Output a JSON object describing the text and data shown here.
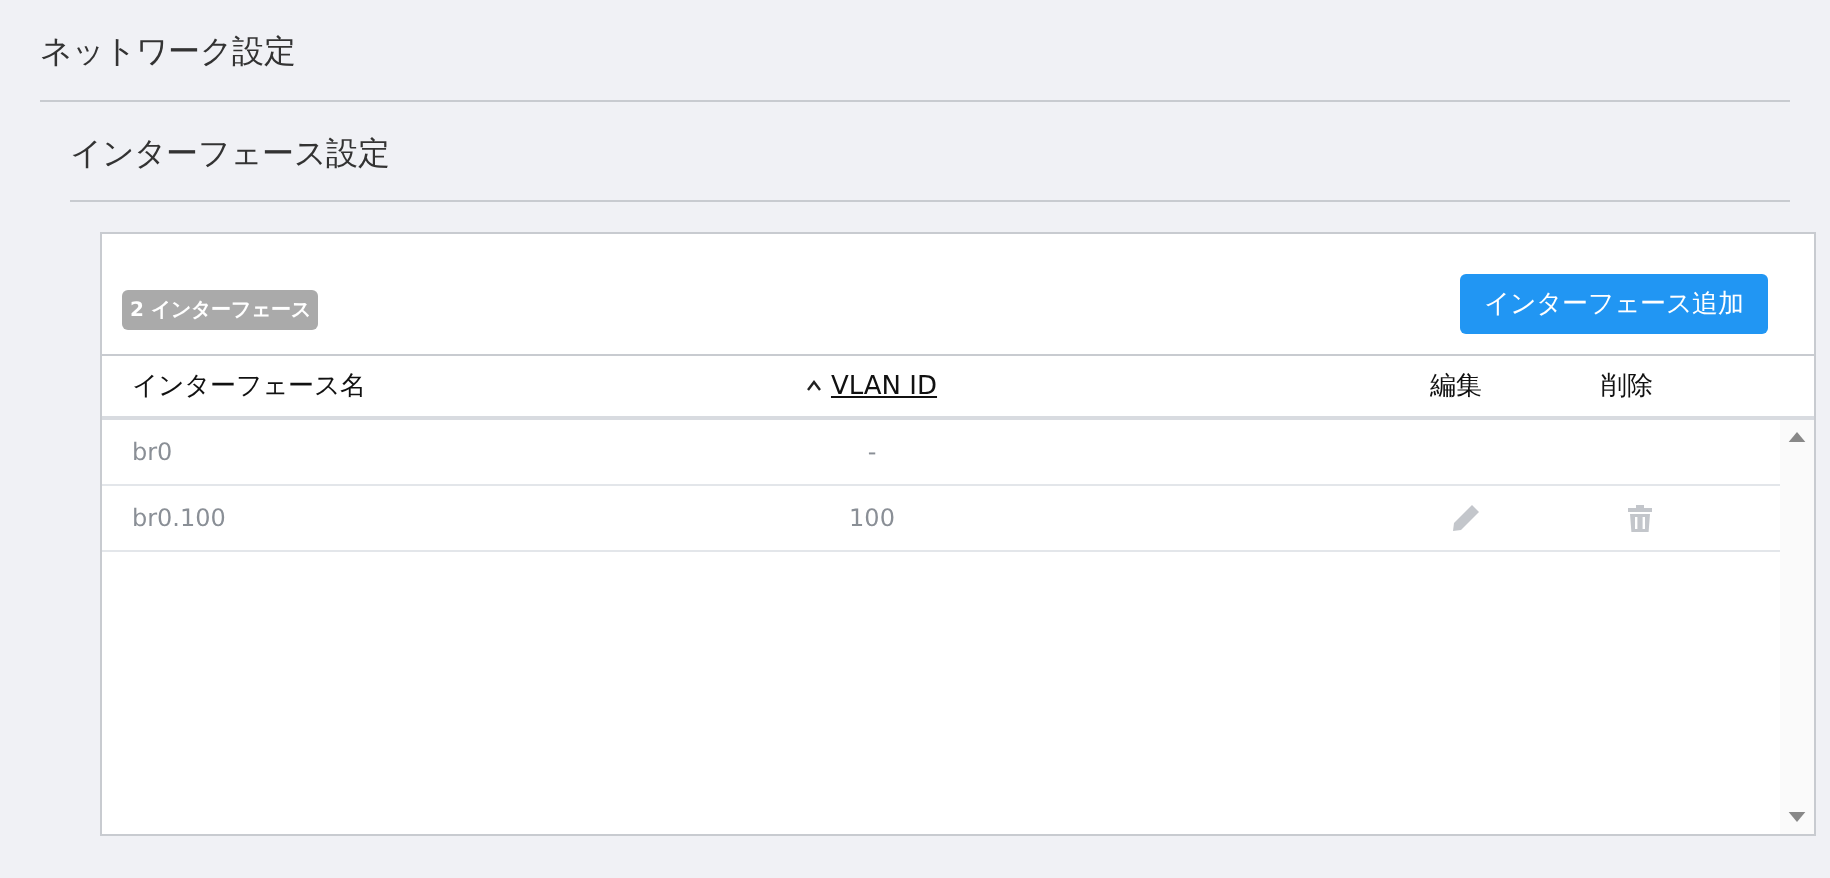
{
  "page_title": "ネットワーク設定",
  "section_title": "インターフェース設定",
  "count_badge": "2 インターフェース",
  "add_button": "インターフェース追加",
  "table": {
    "columns": [
      {
        "label": "インターフェース名",
        "sortable": false
      },
      {
        "label": "VLAN ID",
        "sortable": true
      },
      {
        "label": "編集",
        "sortable": false
      },
      {
        "label": "削除",
        "sortable": false
      }
    ],
    "rows": [
      {
        "name": "br0",
        "vlan_id": "-",
        "editable": false
      },
      {
        "name": "br0.100",
        "vlan_id": "100",
        "editable": true
      }
    ]
  }
}
